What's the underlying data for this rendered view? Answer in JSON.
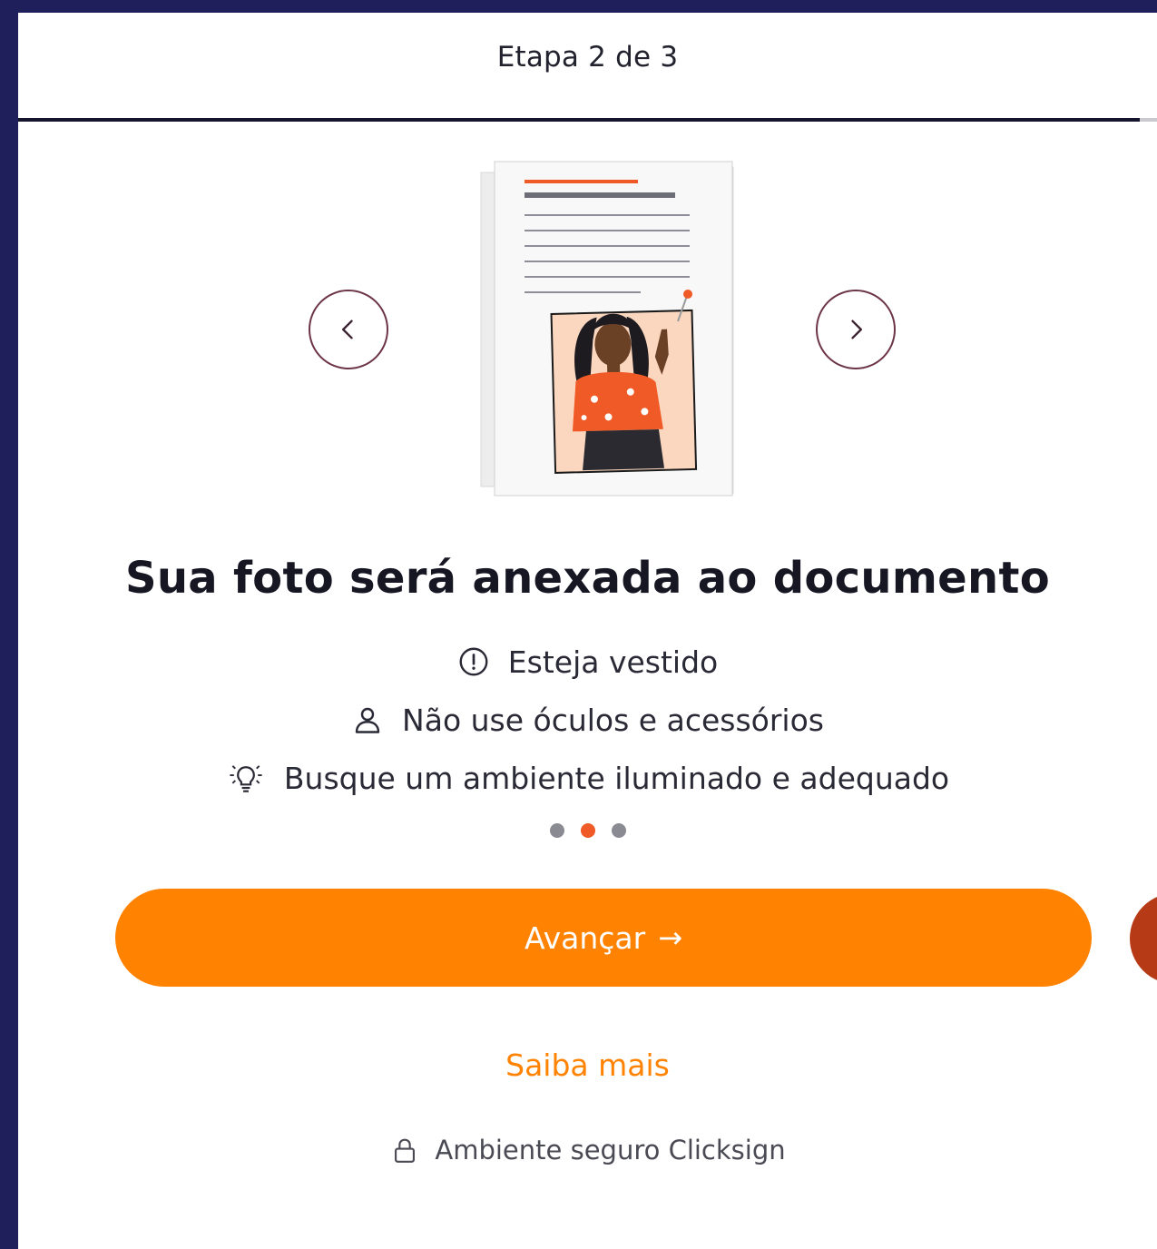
{
  "header": {
    "step_label": "Etapa 2 de 3"
  },
  "progress": {
    "fraction": 0.985
  },
  "carousel": {
    "prev_icon": "chevron-left-icon",
    "next_icon": "chevron-right-icon",
    "active_index": 1,
    "total": 3
  },
  "content": {
    "title": "Sua foto será anexada ao documento",
    "tips": [
      {
        "icon": "alert-circle-icon",
        "text": "Esteja vestido"
      },
      {
        "icon": "user-icon",
        "text": "Não use óculos e acessórios"
      },
      {
        "icon": "lightbulb-icon",
        "text": "Busque um ambiente iluminado e adequado"
      }
    ]
  },
  "actions": {
    "primary_label": "Avançar",
    "primary_icon": "arrow-right-icon",
    "learn_more": "Saiba mais"
  },
  "footer": {
    "secure_text": "Ambiente seguro Clicksign",
    "icon": "lock-icon"
  },
  "colors": {
    "accent": "#ff8200",
    "active_dot": "#f05a26",
    "frame": "#1f1f5b",
    "nav_border": "#6c3447"
  }
}
